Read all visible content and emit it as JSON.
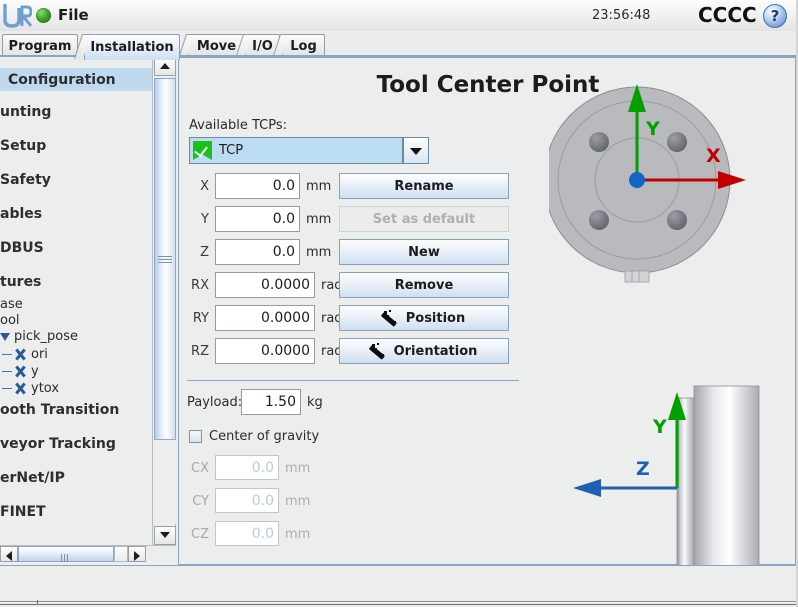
{
  "window": {
    "file_menu": "File",
    "clock": "23:56:48",
    "robot_name": "CCCC",
    "help_glyph": "?",
    "logo_text": "UR"
  },
  "tabs": [
    {
      "label": "Program",
      "active": false
    },
    {
      "label": "Installation",
      "active": true
    },
    {
      "label": "Move",
      "active": false
    },
    {
      "label": "I/O",
      "active": false
    },
    {
      "label": "Log",
      "active": false
    }
  ],
  "sidebar": {
    "items": [
      {
        "label": "Configuration",
        "selected": true,
        "clipped_from": "TCP Configuration"
      },
      {
        "label": "unting",
        "selected": false,
        "clipped_from": "Mounting"
      },
      {
        "label": "Setup",
        "selected": false,
        "clipped_from": "I/O Setup"
      },
      {
        "label": "Safety",
        "selected": false,
        "clipped_from": "Safety"
      },
      {
        "label": "ables",
        "selected": false,
        "clipped_from": "Variables"
      },
      {
        "label": "DBUS",
        "selected": false,
        "clipped_from": "MODBUS"
      },
      {
        "label": "tures",
        "selected": false,
        "clipped_from": "Features"
      }
    ],
    "feature_children": [
      {
        "label": "ase",
        "clipped_from": "Base",
        "kind": "plain"
      },
      {
        "label": "ool",
        "clipped_from": "Tool",
        "kind": "plain"
      },
      {
        "label": "pick_pose",
        "kind": "expanded"
      },
      {
        "label": "ori",
        "kind": "variable"
      },
      {
        "label": "y",
        "kind": "variable"
      },
      {
        "label": "ytox",
        "kind": "variable"
      }
    ],
    "items_lower": [
      {
        "label": "ooth Transition",
        "clipped_from": "Smooth Transition"
      },
      {
        "label": "veyor Tracking",
        "clipped_from": "Conveyor Tracking"
      },
      {
        "label": "erNet/IP",
        "clipped_from": "EtherNet/IP"
      },
      {
        "label": "FINET",
        "clipped_from": "PROFINET"
      }
    ]
  },
  "main": {
    "title": "Tool Center Point",
    "available_tcps_label": "Available TCPs:",
    "tcp_select": {
      "value": "TCP",
      "icon": "green-flag-check-icon",
      "options": [
        "TCP"
      ]
    },
    "pose_fields": [
      {
        "name": "X",
        "value": "0.0",
        "unit": "mm",
        "disabled": false
      },
      {
        "name": "Y",
        "value": "0.0",
        "unit": "mm",
        "disabled": false
      },
      {
        "name": "Z",
        "value": "0.0",
        "unit": "mm",
        "disabled": false
      },
      {
        "name": "RX",
        "value": "0.0000",
        "unit": "rad",
        "disabled": false
      },
      {
        "name": "RY",
        "value": "0.0000",
        "unit": "rad",
        "disabled": false
      },
      {
        "name": "RZ",
        "value": "0.0000",
        "unit": "rad",
        "disabled": false
      }
    ],
    "buttons": [
      {
        "label": "Rename",
        "disabled": false,
        "icon": null
      },
      {
        "label": "Set as default",
        "disabled": true,
        "icon": null
      },
      {
        "label": "New",
        "disabled": false,
        "icon": null
      },
      {
        "label": "Remove",
        "disabled": false,
        "icon": null
      },
      {
        "label": "Position",
        "disabled": false,
        "icon": "magic-wand-icon"
      },
      {
        "label": "Orientation",
        "disabled": false,
        "icon": "magic-wand-icon"
      }
    ],
    "payload": {
      "label": "Payload:",
      "value": "1.50",
      "unit": "kg"
    },
    "center_of_gravity": {
      "label": "Center of gravity",
      "checked": false,
      "fields": [
        {
          "name": "CX",
          "value": "0.0",
          "unit": "mm",
          "disabled": true
        },
        {
          "name": "CY",
          "value": "0.0",
          "unit": "mm",
          "disabled": true
        },
        {
          "name": "CZ",
          "value": "0.0",
          "unit": "mm",
          "disabled": true
        }
      ]
    },
    "diagram": {
      "front_view_axes": [
        {
          "label": "X",
          "color": "#c00000",
          "direction": "right"
        },
        {
          "label": "Y",
          "color": "#00a000",
          "direction": "up"
        }
      ],
      "side_view_axes": [
        {
          "label": "Y",
          "color": "#00a000",
          "direction": "up"
        },
        {
          "label": "Z",
          "color": "#1f5fb4",
          "direction": "left"
        }
      ],
      "origin_marker_color": "#1565c8"
    }
  },
  "colors": {
    "accent": "#8aa5c4",
    "selection": "#bfd9ef",
    "combo_fill": "#bcdcf2",
    "flag_green": "#18c218",
    "axis_x": "#c00000",
    "axis_y": "#00a000",
    "axis_z": "#1f5fb4",
    "focus_yellow": "#f7f246"
  }
}
